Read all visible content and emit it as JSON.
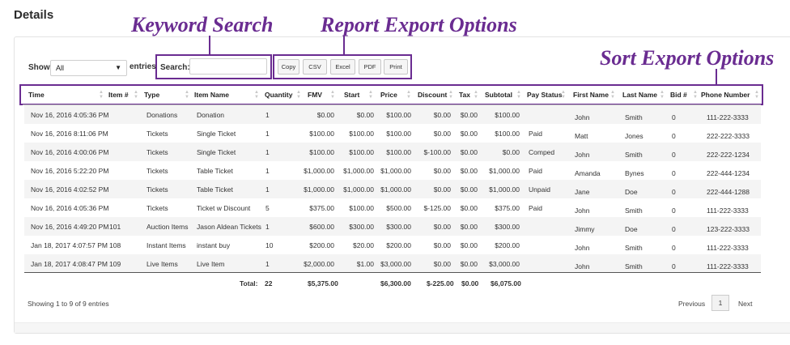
{
  "page": {
    "title": "Details"
  },
  "annotations": {
    "keyword_search": "Keyword Search",
    "report_export": "Report Export Options",
    "sort_export": "Sort Export Options"
  },
  "controls": {
    "show_label": "Show",
    "show_value": "All",
    "entries_label": "entries",
    "search_label": "Search:",
    "search_value": ""
  },
  "export_buttons": [
    "Copy",
    "CSV",
    "Excel",
    "PDF",
    "Print"
  ],
  "table": {
    "columns": [
      "Time",
      "Item #",
      "Type",
      "Item Name",
      "Quantity",
      "FMV",
      "Start",
      "Price",
      "Discount",
      "Tax",
      "Subtotal",
      "Pay Status",
      "First Name",
      "Last Name",
      "Bid #",
      "Phone Number"
    ],
    "rows": [
      [
        "Nov 16, 2016 4:05:36 PM",
        "",
        "Donations",
        "Donation",
        "1",
        "$0.00",
        "$0.00",
        "$100.00",
        "$0.00",
        "$0.00",
        "$100.00",
        "",
        "John",
        "Smith",
        "0",
        "111-222-3333"
      ],
      [
        "Nov 16, 2016 8:11:06 PM",
        "",
        "Tickets",
        "Single Ticket",
        "1",
        "$100.00",
        "$100.00",
        "$100.00",
        "$0.00",
        "$0.00",
        "$100.00",
        "Paid",
        "Matt",
        "Jones",
        "0",
        "222-222-3333"
      ],
      [
        "Nov 16, 2016 4:00:06 PM",
        "",
        "Tickets",
        "Single Ticket",
        "1",
        "$100.00",
        "$100.00",
        "$100.00",
        "$-100.00",
        "$0.00",
        "$0.00",
        "Comped",
        "John",
        "Smith",
        "0",
        "222-222-1234"
      ],
      [
        "Nov 16, 2016 5:22:20 PM",
        "",
        "Tickets",
        "Table Ticket",
        "1",
        "$1,000.00",
        "$1,000.00",
        "$1,000.00",
        "$0.00",
        "$0.00",
        "$1,000.00",
        "Paid",
        "Amanda",
        "Bynes",
        "0",
        "222-444-1234"
      ],
      [
        "Nov 16, 2016 4:02:52 PM",
        "",
        "Tickets",
        "Table Ticket",
        "1",
        "$1,000.00",
        "$1,000.00",
        "$1,000.00",
        "$0.00",
        "$0.00",
        "$1,000.00",
        "Unpaid",
        "Jane",
        "Doe",
        "0",
        "222-444-1288"
      ],
      [
        "Nov 16, 2016 4:05:36 PM",
        "",
        "Tickets",
        "Ticket w Discount",
        "5",
        "$375.00",
        "$100.00",
        "$500.00",
        "$-125.00",
        "$0.00",
        "$375.00",
        "Paid",
        "John",
        "Smith",
        "0",
        "111-222-3333"
      ],
      [
        "Nov 16, 2016 4:49:20 PM",
        "101",
        "Auction Items",
        "Jason Aldean Tickets",
        "1",
        "$600.00",
        "$300.00",
        "$300.00",
        "$0.00",
        "$0.00",
        "$300.00",
        "",
        "Jimmy",
        "Doe",
        "0",
        "123-222-3333"
      ],
      [
        "Jan 18, 2017 4:07:57 PM",
        "108",
        "Instant Items",
        "instant buy",
        "10",
        "$200.00",
        "$20.00",
        "$200.00",
        "$0.00",
        "$0.00",
        "$200.00",
        "",
        "John",
        "Smith",
        "0",
        "111-222-3333"
      ],
      [
        "Jan 18, 2017 4:08:47 PM",
        "109",
        "Live Items",
        "Live Item",
        "1",
        "$2,000.00",
        "$1.00",
        "$3,000.00",
        "$0.00",
        "$0.00",
        "$3,000.00",
        "",
        "John",
        "Smith",
        "0",
        "111-222-3333"
      ]
    ],
    "totals": {
      "label": "Total:",
      "quantity": "22",
      "fmv": "$5,375.00",
      "price": "$6,300.00",
      "discount": "$-225.00",
      "tax": "$0.00",
      "subtotal": "$6,075.00"
    }
  },
  "footer": {
    "info": "Showing 1 to 9 of 9 entries",
    "previous": "Previous",
    "page": "1",
    "next": "Next"
  },
  "colors": {
    "annotation": "#6a2c91",
    "stripe": "#f4f4f4"
  }
}
